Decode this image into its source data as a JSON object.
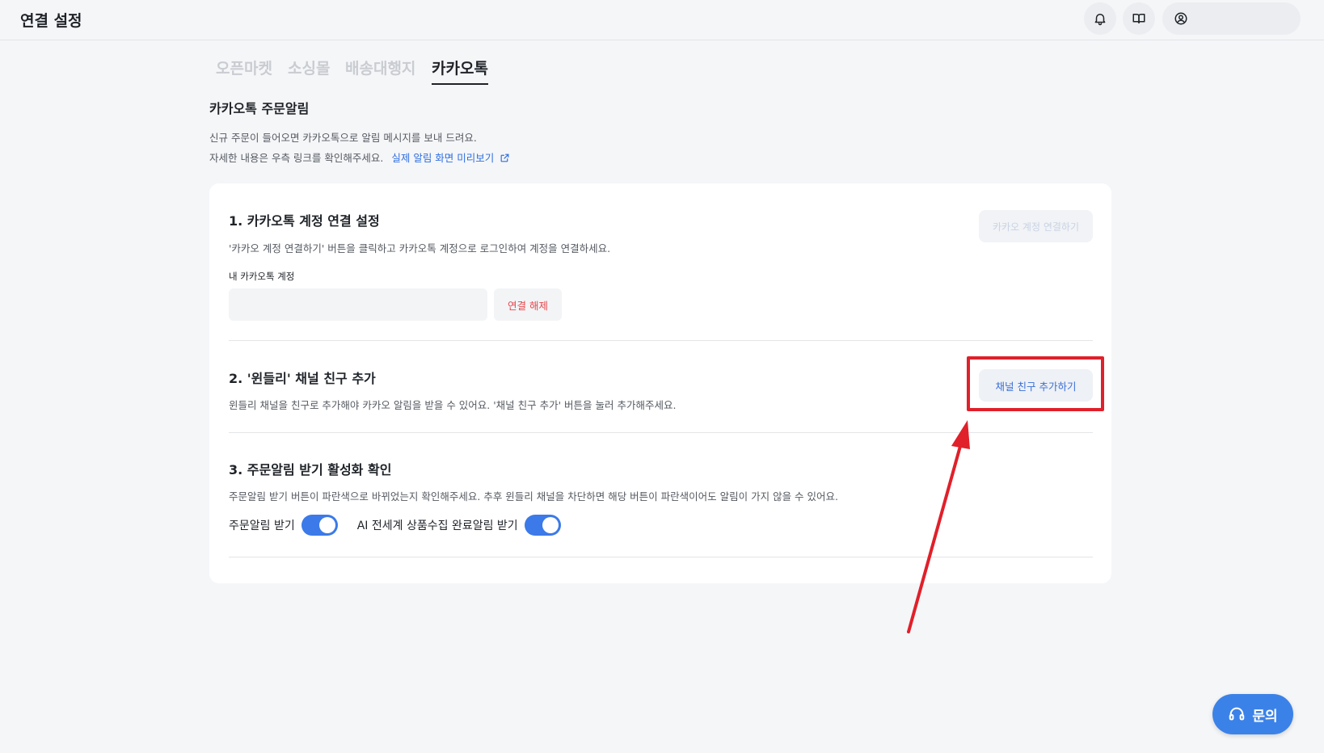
{
  "header": {
    "title": "연결 설정",
    "icons": [
      "bell-icon",
      "book-icon",
      "user-icon"
    ]
  },
  "tabs": [
    {
      "label": "오픈마켓",
      "active": false
    },
    {
      "label": "소싱몰",
      "active": false
    },
    {
      "label": "배송대행지",
      "active": false
    },
    {
      "label": "카카오톡",
      "active": true
    }
  ],
  "section": {
    "title": "카카오톡 주문알림",
    "desc1": "신규 주문이 들어오면 카카오톡으로 알림 메시지를 보내 드려요.",
    "desc2": "자세한 내용은 우측 링크를 확인해주세요.",
    "preview_link": "실제 알림 화면 미리보기"
  },
  "step1": {
    "title": "1. 카카오톡 계정 연결 설정",
    "desc": "'카카오 계정 연결하기' 버튼을 클릭하고 카카오톡 계정으로 로그인하여 계정을 연결하세요.",
    "connect_button": "카카오 계정 연결하기",
    "account_label": "내 카카오톡 계정",
    "account_value": "",
    "disconnect_button": "연결 해제"
  },
  "step2": {
    "title": "2. '윈들리' 채널 친구 추가",
    "desc": "윈들리 채널을 친구로 추가해야 카카오 알림을 받을 수 있어요. '채널 친구 추가' 버튼을 눌러 추가해주세요.",
    "friend_button": "채널 친구 추가하기"
  },
  "step3": {
    "title": "3. 주문알림 받기 활성화 확인",
    "desc": "주문알림 받기 버튼이 파란색으로 바뀌었는지 확인해주세요. 추후 윈들리 채널을 차단하면 해당 버튼이 파란색이어도 알림이 가지 않을 수 있어요.",
    "toggles": [
      {
        "label": "주문알림 받기",
        "on": true
      },
      {
        "label": "AI 전세계 상품수집 완료알림 받기",
        "on": true
      }
    ]
  },
  "help_button": "문의",
  "colors": {
    "accent": "#3b7ae8",
    "link": "#2f6fe0",
    "danger": "#e5484d",
    "annotation": "#e0202a"
  }
}
